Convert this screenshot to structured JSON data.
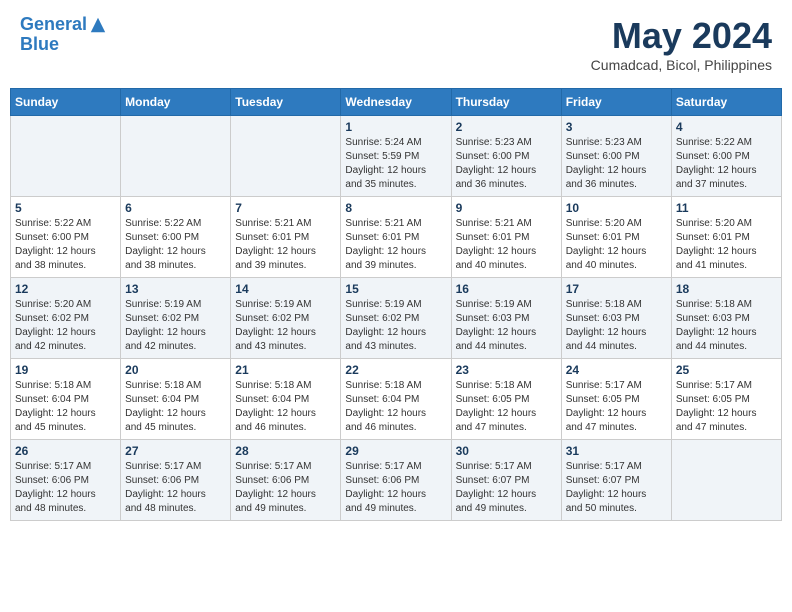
{
  "header": {
    "logo_line1": "General",
    "logo_line2": "Blue",
    "month": "May 2024",
    "location": "Cumadcad, Bicol, Philippines"
  },
  "days_of_week": [
    "Sunday",
    "Monday",
    "Tuesday",
    "Wednesday",
    "Thursday",
    "Friday",
    "Saturday"
  ],
  "weeks": [
    [
      {
        "day": "",
        "info": ""
      },
      {
        "day": "",
        "info": ""
      },
      {
        "day": "",
        "info": ""
      },
      {
        "day": "1",
        "info": "Sunrise: 5:24 AM\nSunset: 5:59 PM\nDaylight: 12 hours\nand 35 minutes."
      },
      {
        "day": "2",
        "info": "Sunrise: 5:23 AM\nSunset: 6:00 PM\nDaylight: 12 hours\nand 36 minutes."
      },
      {
        "day": "3",
        "info": "Sunrise: 5:23 AM\nSunset: 6:00 PM\nDaylight: 12 hours\nand 36 minutes."
      },
      {
        "day": "4",
        "info": "Sunrise: 5:22 AM\nSunset: 6:00 PM\nDaylight: 12 hours\nand 37 minutes."
      }
    ],
    [
      {
        "day": "5",
        "info": "Sunrise: 5:22 AM\nSunset: 6:00 PM\nDaylight: 12 hours\nand 38 minutes."
      },
      {
        "day": "6",
        "info": "Sunrise: 5:22 AM\nSunset: 6:00 PM\nDaylight: 12 hours\nand 38 minutes."
      },
      {
        "day": "7",
        "info": "Sunrise: 5:21 AM\nSunset: 6:01 PM\nDaylight: 12 hours\nand 39 minutes."
      },
      {
        "day": "8",
        "info": "Sunrise: 5:21 AM\nSunset: 6:01 PM\nDaylight: 12 hours\nand 39 minutes."
      },
      {
        "day": "9",
        "info": "Sunrise: 5:21 AM\nSunset: 6:01 PM\nDaylight: 12 hours\nand 40 minutes."
      },
      {
        "day": "10",
        "info": "Sunrise: 5:20 AM\nSunset: 6:01 PM\nDaylight: 12 hours\nand 40 minutes."
      },
      {
        "day": "11",
        "info": "Sunrise: 5:20 AM\nSunset: 6:01 PM\nDaylight: 12 hours\nand 41 minutes."
      }
    ],
    [
      {
        "day": "12",
        "info": "Sunrise: 5:20 AM\nSunset: 6:02 PM\nDaylight: 12 hours\nand 42 minutes."
      },
      {
        "day": "13",
        "info": "Sunrise: 5:19 AM\nSunset: 6:02 PM\nDaylight: 12 hours\nand 42 minutes."
      },
      {
        "day": "14",
        "info": "Sunrise: 5:19 AM\nSunset: 6:02 PM\nDaylight: 12 hours\nand 43 minutes."
      },
      {
        "day": "15",
        "info": "Sunrise: 5:19 AM\nSunset: 6:02 PM\nDaylight: 12 hours\nand 43 minutes."
      },
      {
        "day": "16",
        "info": "Sunrise: 5:19 AM\nSunset: 6:03 PM\nDaylight: 12 hours\nand 44 minutes."
      },
      {
        "day": "17",
        "info": "Sunrise: 5:18 AM\nSunset: 6:03 PM\nDaylight: 12 hours\nand 44 minutes."
      },
      {
        "day": "18",
        "info": "Sunrise: 5:18 AM\nSunset: 6:03 PM\nDaylight: 12 hours\nand 44 minutes."
      }
    ],
    [
      {
        "day": "19",
        "info": "Sunrise: 5:18 AM\nSunset: 6:04 PM\nDaylight: 12 hours\nand 45 minutes."
      },
      {
        "day": "20",
        "info": "Sunrise: 5:18 AM\nSunset: 6:04 PM\nDaylight: 12 hours\nand 45 minutes."
      },
      {
        "day": "21",
        "info": "Sunrise: 5:18 AM\nSunset: 6:04 PM\nDaylight: 12 hours\nand 46 minutes."
      },
      {
        "day": "22",
        "info": "Sunrise: 5:18 AM\nSunset: 6:04 PM\nDaylight: 12 hours\nand 46 minutes."
      },
      {
        "day": "23",
        "info": "Sunrise: 5:18 AM\nSunset: 6:05 PM\nDaylight: 12 hours\nand 47 minutes."
      },
      {
        "day": "24",
        "info": "Sunrise: 5:17 AM\nSunset: 6:05 PM\nDaylight: 12 hours\nand 47 minutes."
      },
      {
        "day": "25",
        "info": "Sunrise: 5:17 AM\nSunset: 6:05 PM\nDaylight: 12 hours\nand 47 minutes."
      }
    ],
    [
      {
        "day": "26",
        "info": "Sunrise: 5:17 AM\nSunset: 6:06 PM\nDaylight: 12 hours\nand 48 minutes."
      },
      {
        "day": "27",
        "info": "Sunrise: 5:17 AM\nSunset: 6:06 PM\nDaylight: 12 hours\nand 48 minutes."
      },
      {
        "day": "28",
        "info": "Sunrise: 5:17 AM\nSunset: 6:06 PM\nDaylight: 12 hours\nand 49 minutes."
      },
      {
        "day": "29",
        "info": "Sunrise: 5:17 AM\nSunset: 6:06 PM\nDaylight: 12 hours\nand 49 minutes."
      },
      {
        "day": "30",
        "info": "Sunrise: 5:17 AM\nSunset: 6:07 PM\nDaylight: 12 hours\nand 49 minutes."
      },
      {
        "day": "31",
        "info": "Sunrise: 5:17 AM\nSunset: 6:07 PM\nDaylight: 12 hours\nand 50 minutes."
      },
      {
        "day": "",
        "info": ""
      }
    ]
  ]
}
